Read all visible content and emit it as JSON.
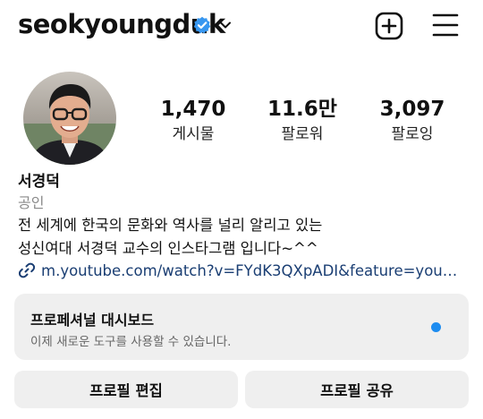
{
  "header": {
    "username": "seokyoungduk",
    "verified_icon": "verified-badge-icon",
    "dropdown_icon": "chevron-down-icon",
    "new_post_icon": "plus-square-icon",
    "menu_icon": "hamburger-menu-icon"
  },
  "profile": {
    "avatar_icon": "profile-photo",
    "stats": [
      {
        "value": "1,470",
        "label": "게시물"
      },
      {
        "value": "11.6만",
        "label": "팔로워"
      },
      {
        "value": "3,097",
        "label": "팔로잉"
      }
    ],
    "name": "서경덕",
    "category": "공인",
    "bio_line1": "전 세계에 한국의 문화와 역사를 널리 알리고 있는",
    "bio_line2": "성신여대 서경덕 교수의 인스타그램 입니다~^^",
    "link_icon": "link-icon",
    "link": "m.youtube.com/watch?v=FYdK3QXpADI&feature=youtu…"
  },
  "dashboard": {
    "title": "프로페셔널 대시보드",
    "subtitle": "이제 새로운 도구를 사용할 수 있습니다.",
    "dot_color": "#1d8cf0"
  },
  "actions": {
    "edit_profile": "프로필 편집",
    "share_profile": "프로필 공유"
  },
  "colors": {
    "link": "#1a3e73",
    "verified": "#3897f0",
    "button_bg": "#efefef"
  }
}
